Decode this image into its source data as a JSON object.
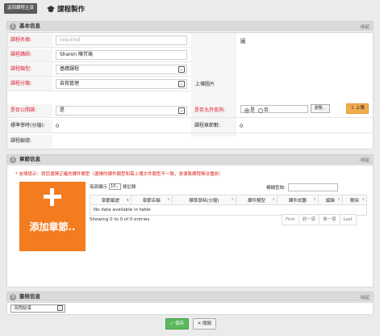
{
  "header": {
    "back_label": "返回課程主頁",
    "title": "課程製作"
  },
  "sections": {
    "basic": {
      "num": "1",
      "title": "基本信息",
      "collapse": "-收起"
    },
    "chapter": {
      "num": "2",
      "title": "章節信息",
      "collapse": "-收起"
    },
    "approval": {
      "num": "3",
      "title": "簽核信息",
      "collapse": "-收起"
    }
  },
  "basic": {
    "course_name": {
      "label": "課程名稱:",
      "placeholder": "required",
      "value": ""
    },
    "instructor": {
      "label": "課程講師:",
      "value": "Sharon 陳芳瑜"
    },
    "course_type": {
      "label": "課程類型:",
      "value": "基礎課程"
    },
    "category": {
      "label": "課程分類:",
      "value": "自我管理"
    },
    "is_public": {
      "label": "是否公開課:",
      "value": "是"
    },
    "standard_hours": {
      "label": "標準學時(分鐘):",
      "value": "0"
    },
    "course_code": {
      "label": "課程編號:",
      "value": ""
    },
    "upload": {
      "label": "上傳圖片",
      "image_alt": "圖",
      "browse_label": "瀏覽...",
      "upload_label": "上傳"
    },
    "allow_query": {
      "label": "是否允許查詢:",
      "options": [
        "是",
        "否"
      ],
      "selected": "是"
    },
    "chapter_count": {
      "label": "課程章節數:",
      "value": "0"
    }
  },
  "chapter": {
    "hint": "* 友情提示：請您選擇正確的課件類型（選擇的課件類型和需上傳文件類型不一致，會導致課程無法播放）",
    "add_label": "添加章節..",
    "length_prefix": "每頁顯示",
    "length_value": "10",
    "length_suffix": "條記錄",
    "search_label": "模糊查詢:",
    "columns": [
      "章節編號",
      "章節名稱",
      "標準學時(分鐘)",
      "課件類型",
      "課件試聽",
      "編輯",
      "刪除"
    ],
    "empty_text": "No data available in table",
    "info": "Showing 0 to 0 of 0 entries",
    "pager": [
      "First",
      "前一頁",
      "後一頁",
      "Last"
    ]
  },
  "approval": {
    "flow_value": "流程結束"
  },
  "footer": {
    "save_label": "保存",
    "close_label": "關閉"
  }
}
